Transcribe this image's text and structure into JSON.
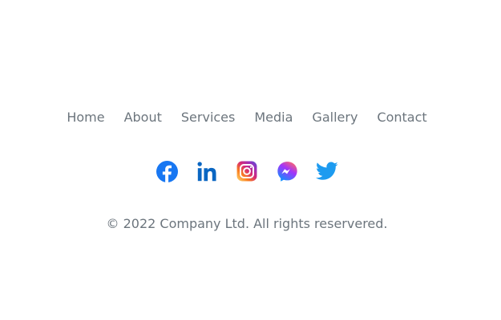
{
  "nav": {
    "items": [
      {
        "label": "Home"
      },
      {
        "label": "About"
      },
      {
        "label": "Services"
      },
      {
        "label": "Media"
      },
      {
        "label": "Gallery"
      },
      {
        "label": "Contact"
      }
    ]
  },
  "social": {
    "icons": [
      "facebook-icon",
      "linkedin-icon",
      "instagram-icon",
      "messenger-icon",
      "twitter-icon"
    ]
  },
  "colors": {
    "text": "#6c757d",
    "facebook": "#1877f2",
    "linkedin": "#0a66c2",
    "twitter": "#1d9bf0",
    "messenger_start": "#0695ff",
    "messenger_end": "#a334fa"
  },
  "footer": {
    "copyright": "© 2022 Company Ltd. All rights reservered."
  }
}
